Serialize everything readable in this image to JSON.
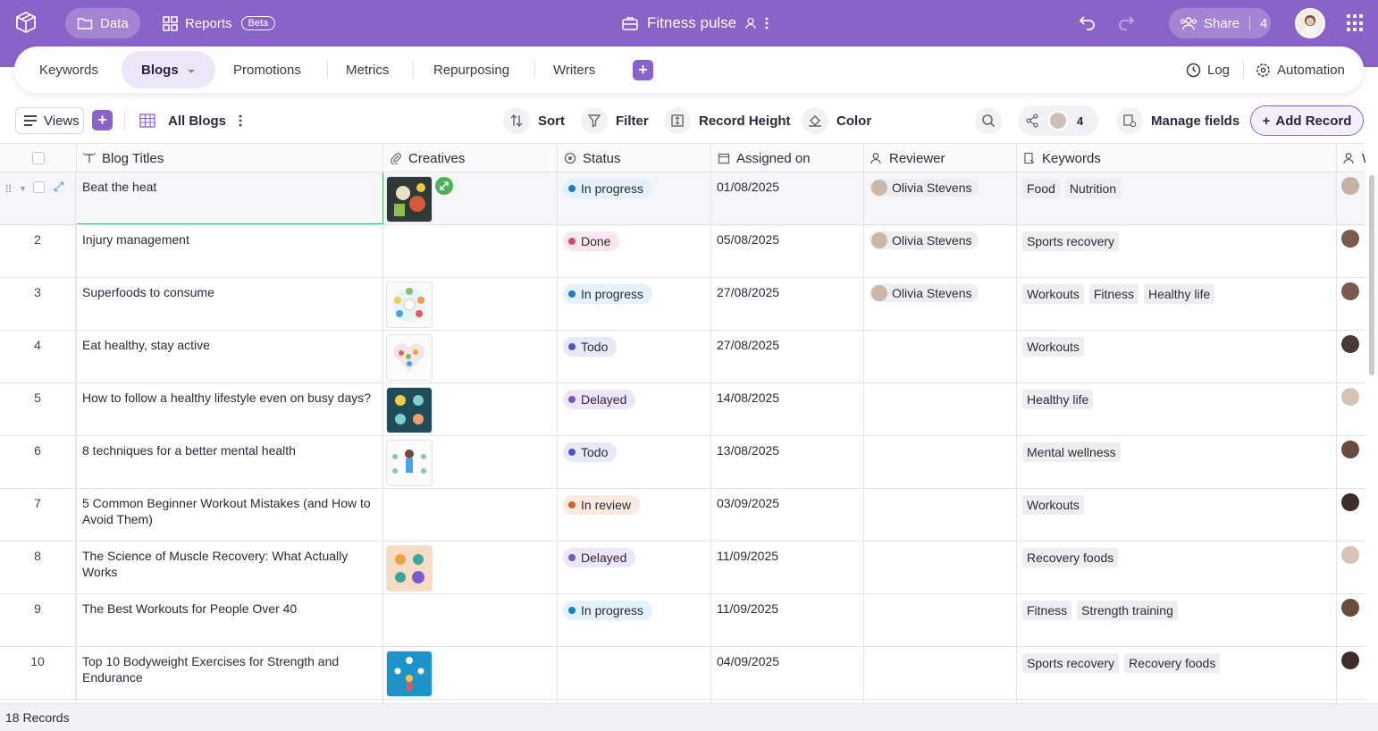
{
  "topbar": {
    "data_label": "Data",
    "reports_label": "Reports",
    "beta_label": "Beta",
    "app_title": "Fitness pulse",
    "share_label": "Share",
    "share_count": "4",
    "accent": "#8a63c8"
  },
  "tabs": [
    {
      "label": "Keywords"
    },
    {
      "label": "Blogs"
    },
    {
      "label": "Promotions"
    },
    {
      "label": "Metrics"
    },
    {
      "label": "Repurposing"
    },
    {
      "label": "Writers"
    }
  ],
  "tabs_right": {
    "log_label": "Log",
    "automation_label": "Automation"
  },
  "toolbar": {
    "views_label": "Views",
    "view_name": "All Blogs",
    "sort_label": "Sort",
    "filter_label": "Filter",
    "record_height_label": "Record Height",
    "color_label": "Color",
    "collaborators_count": "4",
    "manage_fields_label": "Manage fields",
    "add_record_label": "Add Record"
  },
  "columns": [
    "Blog Titles",
    "Creatives",
    "Status",
    "Assigned on",
    "Reviewer",
    "Keywords",
    "W"
  ],
  "rows": [
    {
      "num": "",
      "title": "Beat the heat",
      "creative": "food",
      "status": "In progress",
      "date": "01/08/2025",
      "reviewer": "Olivia Stevens",
      "keywords": [
        "Food",
        "Nutrition"
      ]
    },
    {
      "num": "2",
      "title": "Injury management",
      "creative": "",
      "status": "Done",
      "date": "05/08/2025",
      "reviewer": "Olivia Stevens",
      "keywords": [
        "Sports recovery"
      ]
    },
    {
      "num": "3",
      "title": "Superfoods to consume",
      "creative": "wheel",
      "status": "In progress",
      "date": "27/08/2025",
      "reviewer": "Olivia Stevens",
      "keywords": [
        "Workouts",
        "Fitness",
        "Healthy life"
      ]
    },
    {
      "num": "4",
      "title": "Eat healthy, stay active",
      "creative": "heart",
      "status": "Todo",
      "date": "27/08/2025",
      "reviewer": "",
      "keywords": [
        "Workouts"
      ]
    },
    {
      "num": "5",
      "title": "How to follow a healthy lifestyle even on busy days?",
      "creative": "teal",
      "status": "Delayed",
      "date": "14/08/2025",
      "reviewer": "",
      "keywords": [
        "Healthy life"
      ]
    },
    {
      "num": "6",
      "title": "8 techniques for a better mental health",
      "creative": "mind",
      "status": "Todo",
      "date": "13/08/2025",
      "reviewer": "",
      "keywords": [
        "Mental wellness"
      ]
    },
    {
      "num": "7",
      "title": "5 Common Beginner Workout Mistakes (and How to Avoid Them)",
      "creative": "",
      "status": "In review",
      "date": "03/09/2025",
      "reviewer": "",
      "keywords": [
        "Workouts"
      ]
    },
    {
      "num": "8",
      "title": "The Science of Muscle Recovery: What Actually Works",
      "creative": "peach",
      "status": "Delayed",
      "date": "11/09/2025",
      "reviewer": "",
      "keywords": [
        "Recovery foods"
      ]
    },
    {
      "num": "9",
      "title": "The Best Workouts for People Over 40",
      "creative": "",
      "status": "In progress",
      "date": "11/09/2025",
      "reviewer": "",
      "keywords": [
        "Fitness",
        "Strength training"
      ]
    },
    {
      "num": "10",
      "title": "Top 10 Bodyweight Exercises for Strength and Endurance",
      "creative": "blue",
      "status": "",
      "date": "04/09/2025",
      "reviewer": "",
      "keywords": [
        "Sports recovery",
        "Recovery foods"
      ]
    }
  ],
  "status_colors": {
    "In progress": {
      "dot": "#1a7fc1",
      "bg": "#e3f1fa"
    },
    "Done": {
      "dot": "#d9497a",
      "bg": "#fbe7ee"
    },
    "Todo": {
      "dot": "#4a57c9",
      "bg": "#e7e9f8"
    },
    "Delayed": {
      "dot": "#7757c2",
      "bg": "#ece6f8"
    },
    "In review": {
      "dot": "#d4612b",
      "bg": "#fbeadf"
    }
  },
  "footer": {
    "records_label": "18 Records"
  }
}
